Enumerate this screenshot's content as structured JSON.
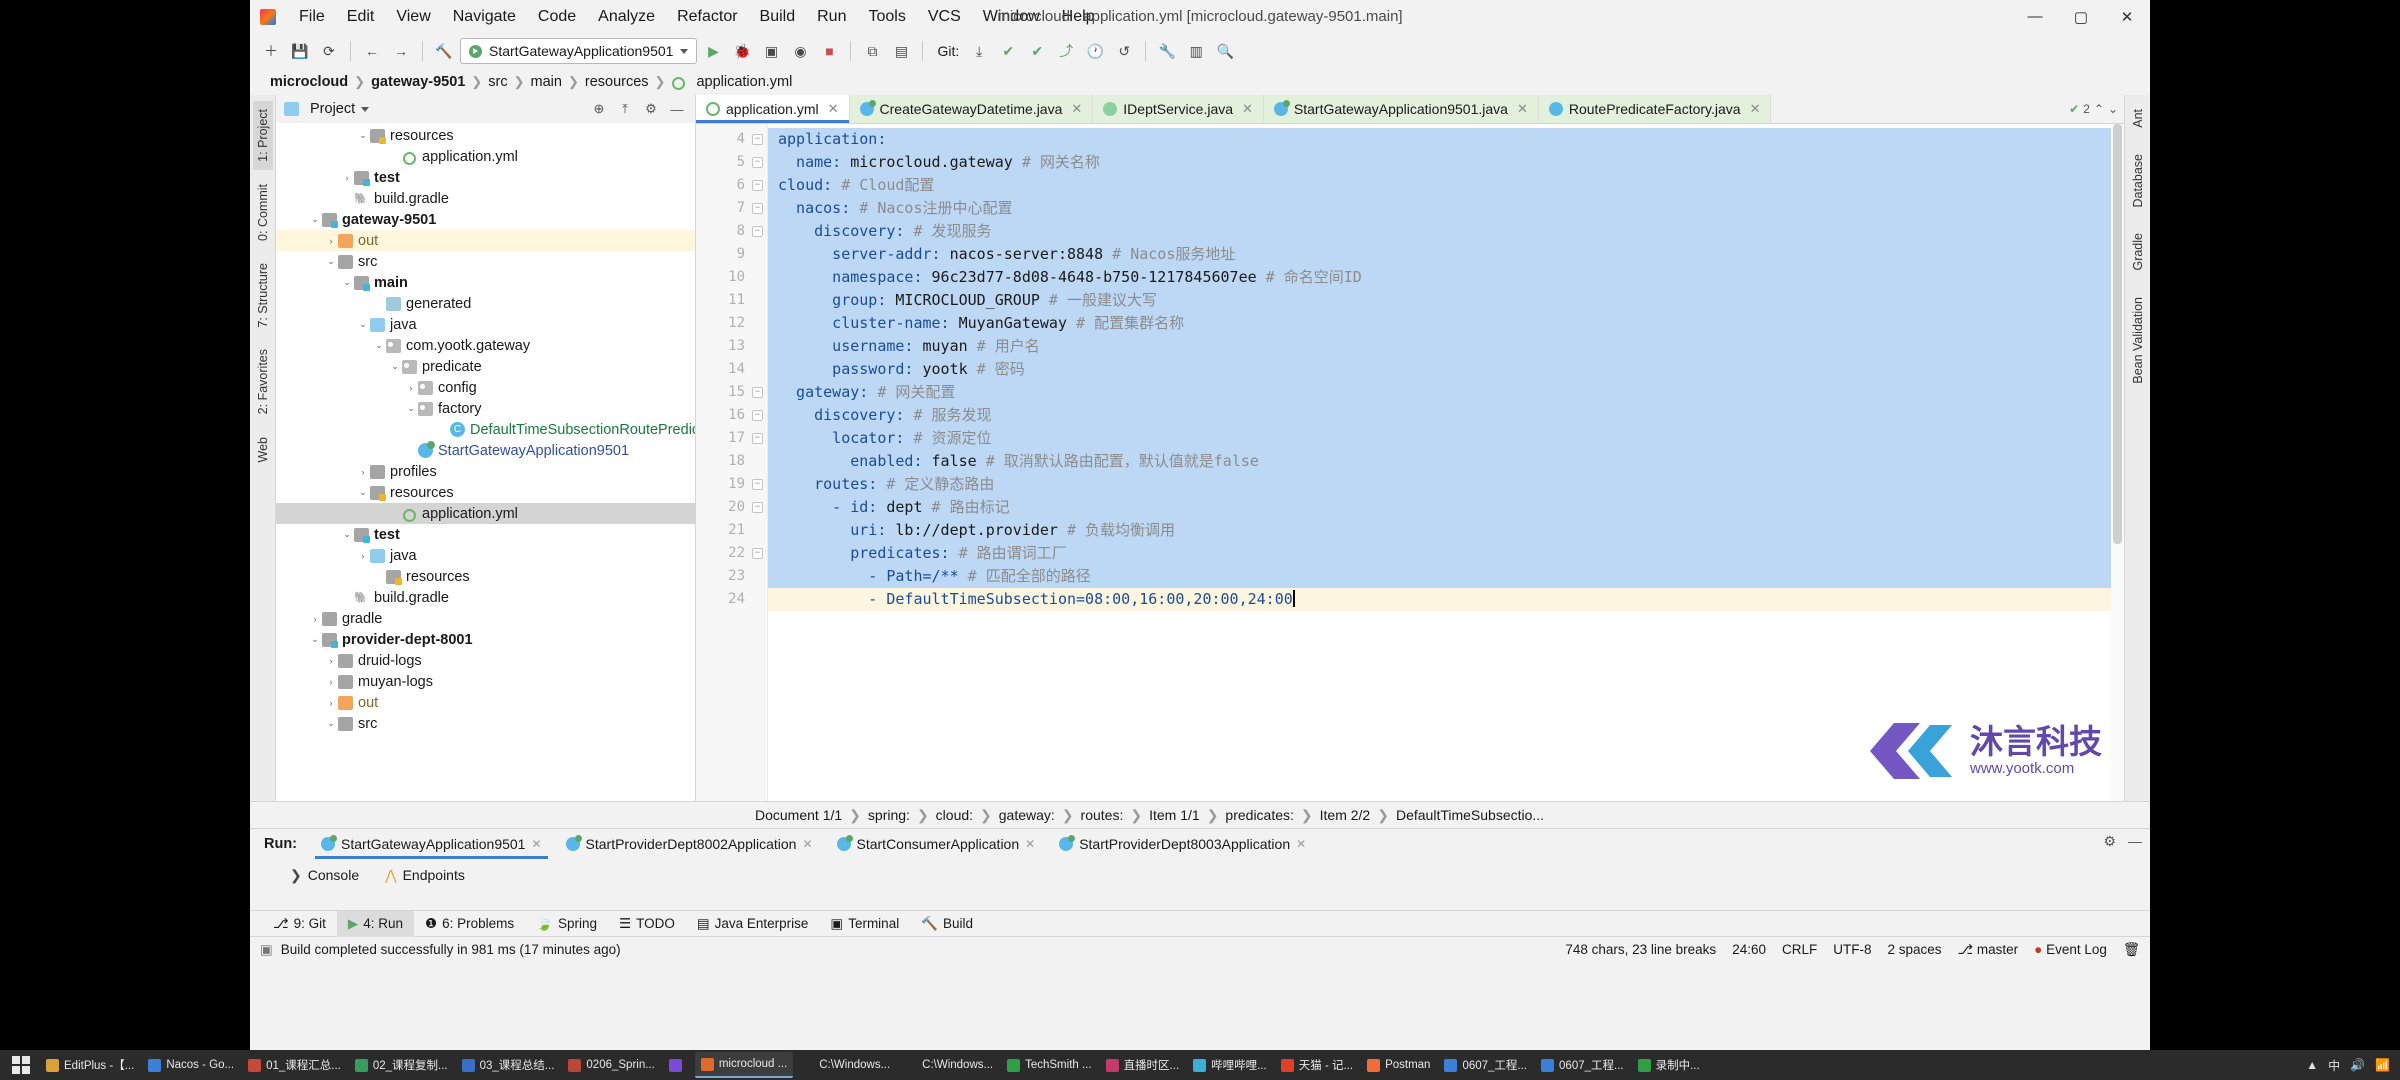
{
  "window": {
    "title": "microcloud - application.yml [microcloud.gateway-9501.main]",
    "minimize": "—",
    "maximize": "▢",
    "close": "✕"
  },
  "menu": [
    "File",
    "Edit",
    "View",
    "Navigate",
    "Code",
    "Analyze",
    "Refactor",
    "Build",
    "Run",
    "Tools",
    "VCS",
    "Window",
    "Help"
  ],
  "toolbar": {
    "run_config": "StartGatewayApplication9501",
    "git_label": "Git:",
    "icons": [
      "add-icon",
      "save-icon",
      "sync-icon",
      "back-arrow-icon",
      "forward-arrow-icon",
      "search-everywhere-icon",
      "run-icon",
      "debug-icon",
      "run-coverage-icon",
      "profiler-icon",
      "stop-icon",
      "build-icon",
      "attach-icon",
      "update-project-icon",
      "commit-icon",
      "push-icon",
      "history-icon",
      "rollback-icon",
      "wrench-icon",
      "structure-icon",
      "search-icon"
    ]
  },
  "navbar": {
    "crumbs": [
      "microcloud",
      "gateway-9501",
      "src",
      "main",
      "resources",
      "application.yml"
    ]
  },
  "left_strip": {
    "tabs": [
      "1: Project",
      "0: Commit",
      "7: Structure",
      "2: Favorites",
      "Web"
    ]
  },
  "right_strip": {
    "tabs": [
      "Ant",
      "Database",
      "Gradle",
      "Bean Validation"
    ]
  },
  "project_panel": {
    "title": "Project",
    "tree": [
      {
        "indent": 5,
        "arrow": "v",
        "icon": "folder-res",
        "label": "resources",
        "style": ""
      },
      {
        "indent": 7,
        "arrow": "",
        "icon": "yml",
        "label": "application.yml",
        "style": ""
      },
      {
        "indent": 4,
        "arrow": ">",
        "icon": "folder-src",
        "label": "test",
        "style": "bold"
      },
      {
        "indent": 4,
        "arrow": "",
        "icon": "gradle",
        "label": "build.gradle",
        "style": ""
      },
      {
        "indent": 2,
        "arrow": "v",
        "icon": "folder-src",
        "label": "gateway-9501",
        "style": "bold"
      },
      {
        "indent": 3,
        "arrow": ">",
        "icon": "folder-out",
        "label": "out",
        "style": "ochre",
        "highlight": true
      },
      {
        "indent": 3,
        "arrow": "v",
        "icon": "folder",
        "label": "src",
        "style": ""
      },
      {
        "indent": 4,
        "arrow": "v",
        "icon": "folder-src",
        "label": "main",
        "style": "bold"
      },
      {
        "indent": 6,
        "arrow": "",
        "icon": "gen",
        "label": "generated",
        "style": ""
      },
      {
        "indent": 5,
        "arrow": "v",
        "icon": "folder-blue",
        "label": "java",
        "style": ""
      },
      {
        "indent": 6,
        "arrow": "v",
        "icon": "pkg",
        "label": "com.yootk.gateway",
        "style": ""
      },
      {
        "indent": 7,
        "arrow": "v",
        "icon": "pkg",
        "label": "predicate",
        "style": ""
      },
      {
        "indent": 8,
        "arrow": ">",
        "icon": "pkg",
        "label": "config",
        "style": ""
      },
      {
        "indent": 8,
        "arrow": "v",
        "icon": "pkg",
        "label": "factory",
        "style": ""
      },
      {
        "indent": 10,
        "arrow": "",
        "icon": "class",
        "label": "DefaultTimeSubsectionRoutePredica",
        "style": "green"
      },
      {
        "indent": 8,
        "arrow": "",
        "icon": "runclass",
        "label": "StartGatewayApplication9501",
        "style": "blue"
      },
      {
        "indent": 5,
        "arrow": ">",
        "icon": "folder",
        "label": "profiles",
        "style": ""
      },
      {
        "indent": 5,
        "arrow": "v",
        "icon": "folder-res",
        "label": "resources",
        "style": ""
      },
      {
        "indent": 7,
        "arrow": "",
        "icon": "yml",
        "label": "application.yml",
        "style": "",
        "selected": true
      },
      {
        "indent": 4,
        "arrow": "v",
        "icon": "folder-src",
        "label": "test",
        "style": "bold"
      },
      {
        "indent": 5,
        "arrow": ">",
        "icon": "folder-blue",
        "label": "java",
        "style": ""
      },
      {
        "indent": 6,
        "arrow": "",
        "icon": "folder-res",
        "label": "resources",
        "style": ""
      },
      {
        "indent": 4,
        "arrow": "",
        "icon": "gradle",
        "label": "build.gradle",
        "style": ""
      },
      {
        "indent": 2,
        "arrow": ">",
        "icon": "folder",
        "label": "gradle",
        "style": ""
      },
      {
        "indent": 2,
        "arrow": "v",
        "icon": "folder-src",
        "label": "provider-dept-8001",
        "style": "bold"
      },
      {
        "indent": 3,
        "arrow": ">",
        "icon": "folder",
        "label": "druid-logs",
        "style": ""
      },
      {
        "indent": 3,
        "arrow": ">",
        "icon": "folder",
        "label": "muyan-logs",
        "style": ""
      },
      {
        "indent": 3,
        "arrow": ">",
        "icon": "folder-out",
        "label": "out",
        "style": "ochre"
      },
      {
        "indent": 3,
        "arrow": "v",
        "icon": "folder",
        "label": "src",
        "style": ""
      }
    ]
  },
  "editor": {
    "tabs": [
      {
        "label": "application.yml",
        "icon": "yaml-file-icon",
        "active": true,
        "closable": true
      },
      {
        "label": "CreateGatewayDatetime.java",
        "icon": "java-run-class-icon",
        "active": false,
        "closable": true
      },
      {
        "label": "IDeptService.java",
        "icon": "java-interface-icon",
        "active": false,
        "closable": true
      },
      {
        "label": "StartGatewayApplication9501.java",
        "icon": "java-run-class-icon",
        "active": false,
        "closable": true
      },
      {
        "label": "RoutePredicateFactory.java",
        "icon": "java-class-icon",
        "active": false,
        "closable": true
      }
    ],
    "inspection_count": "2",
    "lines": [
      {
        "n": "4",
        "fold": "-",
        "indent": 0,
        "key": "application:",
        "value": "",
        "comment": "",
        "sel": true
      },
      {
        "n": "5",
        "fold": "-",
        "indent": 1,
        "key": "name:",
        "value": " microcloud.gateway",
        "comment": " # 网关名称",
        "sel": true
      },
      {
        "n": "6",
        "fold": "-",
        "indent": 0,
        "key": "cloud:",
        "value": "",
        "comment": " # Cloud配置",
        "sel": true
      },
      {
        "n": "7",
        "fold": "-",
        "indent": 1,
        "key": "nacos:",
        "value": "",
        "comment": " # Nacos注册中心配置",
        "sel": true
      },
      {
        "n": "8",
        "fold": "-",
        "indent": 2,
        "key": "discovery:",
        "value": "",
        "comment": " # 发现服务",
        "sel": true
      },
      {
        "n": "9",
        "fold": "",
        "indent": 3,
        "key": "server-addr:",
        "value": " nacos-server:8848",
        "comment": " # Nacos服务地址",
        "sel": true
      },
      {
        "n": "10",
        "fold": "",
        "indent": 3,
        "key": "namespace:",
        "value": " 96c23d77-8d08-4648-b750-1217845607ee",
        "comment": " # 命名空间ID",
        "sel": true
      },
      {
        "n": "11",
        "fold": "",
        "indent": 3,
        "key": "group:",
        "value": " MICROCLOUD_GROUP",
        "comment": " # 一般建议大写",
        "sel": true
      },
      {
        "n": "12",
        "fold": "",
        "indent": 3,
        "key": "cluster-name:",
        "value": " MuyanGateway",
        "comment": " # 配置集群名称",
        "sel": true
      },
      {
        "n": "13",
        "fold": "",
        "indent": 3,
        "key": "username:",
        "value": " muyan",
        "comment": " # 用户名",
        "sel": true
      },
      {
        "n": "14",
        "fold": "",
        "indent": 3,
        "key": "password:",
        "value": " yootk",
        "comment": " # 密码",
        "sel": true
      },
      {
        "n": "15",
        "fold": "-",
        "indent": 1,
        "key": "gateway:",
        "value": "",
        "comment": " # 网关配置",
        "sel": true
      },
      {
        "n": "16",
        "fold": "-",
        "indent": 2,
        "key": "discovery:",
        "value": "",
        "comment": " # 服务发现",
        "sel": true
      },
      {
        "n": "17",
        "fold": "-",
        "indent": 3,
        "key": "locator:",
        "value": "",
        "comment": " # 资源定位",
        "sel": true
      },
      {
        "n": "18",
        "fold": "",
        "indent": 4,
        "key": "enabled:",
        "value": " false",
        "comment": " # 取消默认路由配置，默认值就是false",
        "sel": true
      },
      {
        "n": "19",
        "fold": "-",
        "indent": 2,
        "key": "routes:",
        "value": "",
        "comment": " # 定义静态路由",
        "sel": true
      },
      {
        "n": "20",
        "fold": "-",
        "indent": 3,
        "key": "- id:",
        "value": " dept",
        "comment": " # 路由标记",
        "sel": true
      },
      {
        "n": "21",
        "fold": "",
        "indent": 4,
        "key": "uri:",
        "value": " lb://dept.provider",
        "comment": " # 负载均衡调用",
        "sel": true
      },
      {
        "n": "22",
        "fold": "-",
        "indent": 4,
        "key": "predicates:",
        "value": "",
        "comment": " # 路由谓词工厂",
        "sel": true
      },
      {
        "n": "23",
        "fold": "",
        "indent": 5,
        "key": "- Path=/**",
        "value": "",
        "comment": " # 匹配全部的路径",
        "sel": true
      },
      {
        "n": "24",
        "fold": "",
        "indent": 5,
        "key": "- DefaultTimeSubsection=08:00,16:00,20:00,24:00",
        "value": "",
        "comment": "",
        "sel": true,
        "current": true,
        "cursor": true
      }
    ]
  },
  "watermark": {
    "brand": "沐言科技",
    "url": "www.yootk.com"
  },
  "doc_breadcrumb": [
    "Document 1/1",
    "spring:",
    "cloud:",
    "gateway:",
    "routes:",
    "Item 1/1",
    "predicates:",
    "Item 2/2",
    "DefaultTimeSubsectio..."
  ],
  "run_window": {
    "label": "Run:",
    "tabs": [
      {
        "label": "StartGatewayApplication9501",
        "active": true
      },
      {
        "label": "StartProviderDept8002Application",
        "active": false
      },
      {
        "label": "StartConsumerApplication",
        "active": false
      },
      {
        "label": "StartProviderDept8003Application",
        "active": false
      }
    ],
    "sub_tabs": [
      {
        "label": "Console",
        "icon": "console-icon"
      },
      {
        "label": "Endpoints",
        "icon": "endpoints-icon"
      }
    ],
    "settings_icon": "gear-icon",
    "minimize_icon": "minimize-icon"
  },
  "bottom_tabs": [
    {
      "label": "9: Git",
      "icon": "git-branch-icon",
      "selected": false
    },
    {
      "label": "4: Run",
      "icon": "run-icon",
      "selected": true
    },
    {
      "label": "6: Problems",
      "icon": "problems-icon",
      "selected": false
    },
    {
      "label": "Spring",
      "icon": "spring-leaf-icon",
      "selected": false
    },
    {
      "label": "TODO",
      "icon": "todo-list-icon",
      "selected": false
    },
    {
      "label": "Java Enterprise",
      "icon": "java-enterprise-icon",
      "selected": false
    },
    {
      "label": "Terminal",
      "icon": "terminal-icon",
      "selected": false
    },
    {
      "label": "Build",
      "icon": "build-hammer-icon",
      "selected": false
    }
  ],
  "statusbar": {
    "message": "Build completed successfully in 981 ms (17 minutes ago)",
    "chars": "748 chars, 23 line breaks",
    "position": "24:60",
    "line_sep": "CRLF",
    "encoding": "UTF-8",
    "indent": "2 spaces",
    "branch": "master",
    "event_log": "Event Log"
  },
  "taskbar": {
    "items": [
      {
        "label": "EditPlus -【...",
        "color": "#d8a13a"
      },
      {
        "label": "Nacos - Go...",
        "color": "#3a7fd8"
      },
      {
        "label": "01_课程汇总...",
        "color": "#c44a3a"
      },
      {
        "label": "02_课程复制...",
        "color": "#3a9c5c"
      },
      {
        "label": "03_课程总结...",
        "color": "#3a6fc4"
      },
      {
        "label": "0206_Sprin...",
        "color": "#b8473a"
      },
      {
        "label": "",
        "color": "#7a4ad8"
      },
      {
        "label": "microcloud ...",
        "color": "#e06a2a",
        "active": true
      },
      {
        "label": "C:\\Windows...",
        "color": "#2b2b2b"
      },
      {
        "label": "C:\\Windows...",
        "color": "#2b2b2b"
      },
      {
        "label": "TechSmith ...",
        "color": "#2f9e44"
      },
      {
        "label": "直播时区...",
        "color": "#c43a6a"
      },
      {
        "label": "哔哩哔哩...",
        "color": "#3ab0d8"
      },
      {
        "label": "天猫 - 记...",
        "color": "#e0402a"
      },
      {
        "label": "Postman",
        "color": "#f26b3a"
      },
      {
        "label": "0607_工程...",
        "color": "#3a7fd8"
      },
      {
        "label": "0607_工程...",
        "color": "#3a7fd8"
      },
      {
        "label": "录制中...",
        "color": "#2f9e44"
      }
    ],
    "tray": [
      "▲",
      "中",
      "🔊",
      "📶"
    ]
  }
}
